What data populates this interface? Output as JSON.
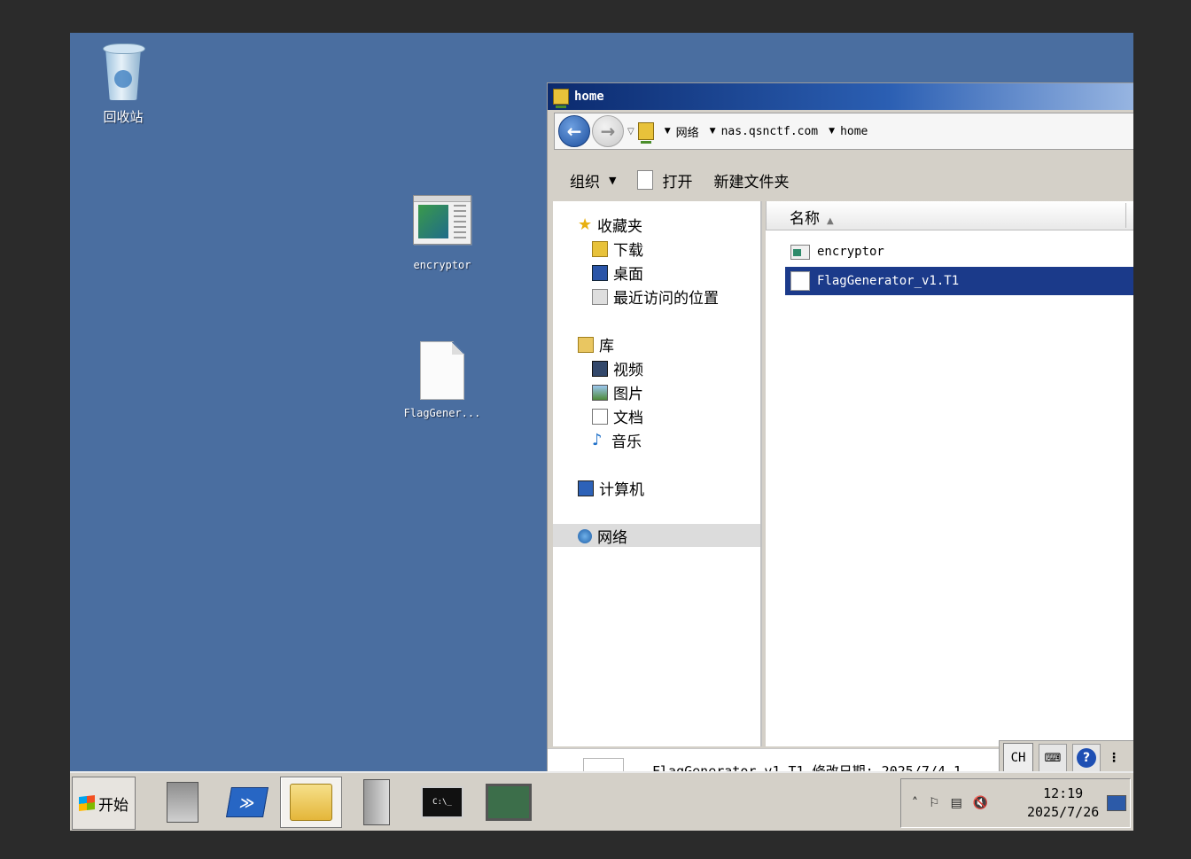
{
  "desktop": {
    "recycle_bin_label": "回收站",
    "icons": [
      {
        "label": "encryptor"
      },
      {
        "label": "FlagGener..."
      }
    ]
  },
  "window": {
    "title": "home",
    "address": {
      "crumbs": [
        "网络",
        "nas.qsnctf.com",
        "home"
      ]
    },
    "commands": {
      "organize": "组织",
      "open": "打开",
      "new_folder": "新建文件夹"
    },
    "nav": {
      "favorites": "收藏夹",
      "downloads": "下载",
      "desktop": "桌面",
      "recent": "最近访问的位置",
      "libraries": "库",
      "videos": "视频",
      "pictures": "图片",
      "documents": "文档",
      "music": "音乐",
      "computer": "计算机",
      "network": "网络"
    },
    "columns": {
      "name": "名称"
    },
    "files": [
      {
        "name": "encryptor",
        "selected": false
      },
      {
        "name": "FlagGenerator_v1.T1",
        "selected": true
      }
    ],
    "details_text": "FlagGenerator_v1.T1 修改日期: 2025/7/4 1"
  },
  "language_bar": {
    "lang": "CH",
    "help": "?"
  },
  "taskbar": {
    "start_label": "开始",
    "time": "12:19",
    "date": "2025/7/26"
  },
  "colors": {
    "desktop": "#4a6ea0",
    "selection": "#1b3a8a",
    "titlebar": "#0b2a6e"
  }
}
